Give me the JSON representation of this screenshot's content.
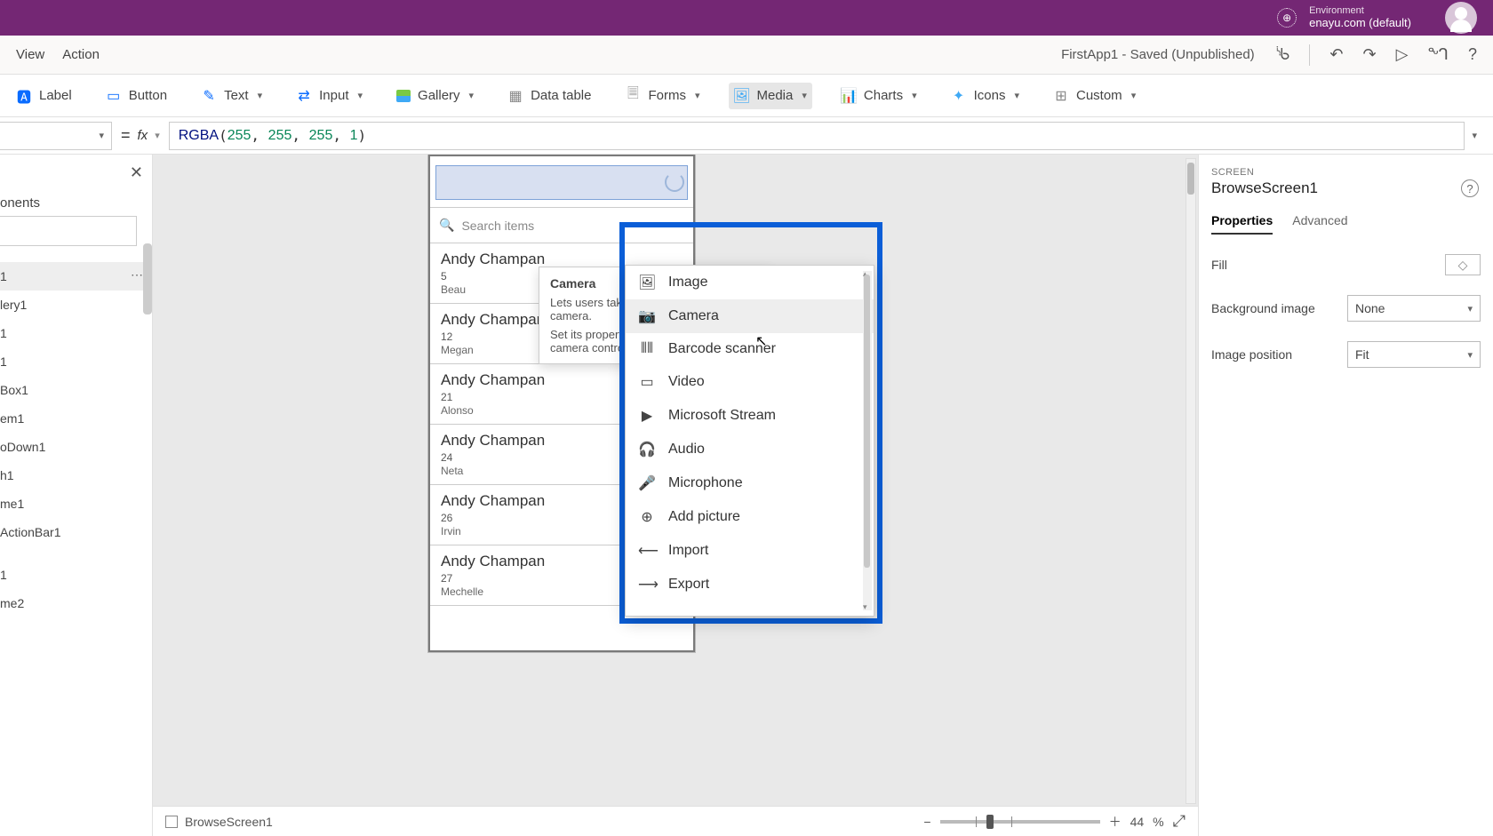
{
  "topbar": {
    "env_label": "Environment",
    "env_value": "enayu.com (default)"
  },
  "appbar": {
    "tabs": [
      "View",
      "Action"
    ],
    "title": "FirstApp1 - Saved (Unpublished)"
  },
  "ribbon": {
    "label": "Label",
    "button": "Button",
    "text": "Text",
    "input": "Input",
    "gallery": "Gallery",
    "datatable": "Data table",
    "forms": "Forms",
    "media": "Media",
    "charts": "Charts",
    "icons": "Icons",
    "custom": "Custom"
  },
  "formula": {
    "fn": "RGBA",
    "args": [
      "255",
      "255",
      "255",
      "1"
    ]
  },
  "tree": {
    "tab": "onents",
    "search_placeholder": "",
    "items": [
      "1",
      "lery1",
      "1",
      "1",
      "Box1",
      "em1",
      "oDown1",
      "h1",
      "me1",
      "ActionBar1",
      "",
      "1",
      "me2"
    ],
    "selected_index": 0
  },
  "tooltip": {
    "title": "Camera",
    "body1": "Lets users take photos from the device camera.",
    "body2": "Set its properties to determine how this camera control looks and behaves."
  },
  "media_dropdown": {
    "items": [
      {
        "icon": "image",
        "label": "Image"
      },
      {
        "icon": "camera",
        "label": "Camera",
        "hover": true
      },
      {
        "icon": "barcode",
        "label": "Barcode scanner"
      },
      {
        "icon": "video",
        "label": "Video"
      },
      {
        "icon": "stream",
        "label": "Microsoft Stream"
      },
      {
        "icon": "audio",
        "label": "Audio"
      },
      {
        "icon": "mic",
        "label": "Microphone"
      },
      {
        "icon": "addpic",
        "label": "Add picture"
      },
      {
        "icon": "import",
        "label": "Import"
      },
      {
        "icon": "export",
        "label": "Export"
      }
    ]
  },
  "canvas": {
    "search_placeholder": "Search items",
    "list": [
      {
        "title": "Andy Champan",
        "id": "5",
        "sub": "Beau"
      },
      {
        "title": "Andy Champan",
        "id": "12",
        "sub": "Megan"
      },
      {
        "title": "Andy Champan",
        "id": "21",
        "sub": "Alonso"
      },
      {
        "title": "Andy Champan",
        "id": "24",
        "sub": "Neta"
      },
      {
        "title": "Andy Champan",
        "id": "26",
        "sub": "Irvin"
      },
      {
        "title": "Andy Champan",
        "id": "27",
        "sub": "Mechelle"
      }
    ]
  },
  "footer": {
    "breadcrumb": "BrowseScreen1",
    "zoom_value": "44",
    "zoom_unit": "%"
  },
  "props": {
    "meta": "SCREEN",
    "name": "BrowseScreen1",
    "tab_properties": "Properties",
    "tab_advanced": "Advanced",
    "fill_label": "Fill",
    "bg_label": "Background image",
    "bg_value": "None",
    "pos_label": "Image position",
    "pos_value": "Fit"
  }
}
